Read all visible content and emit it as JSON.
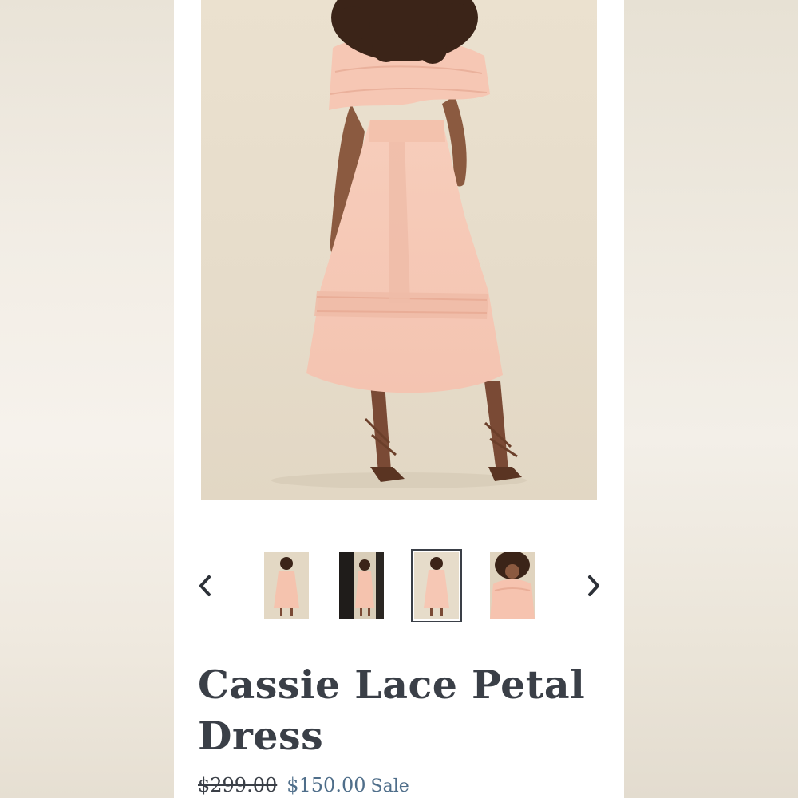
{
  "product": {
    "title": "Cassie Lace Petal Dress",
    "price_original": "$299.00",
    "price_sale": "$150.00",
    "sale_label": "Sale"
  },
  "gallery": {
    "main_image": "dress-back-view-photo",
    "thumbnails": [
      {
        "image": "full-front-view-photo",
        "selected": false
      },
      {
        "image": "doorway-view-photo",
        "selected": false
      },
      {
        "image": "back-view-photo",
        "selected": true
      },
      {
        "image": "closeup-front-view-photo",
        "selected": false
      }
    ],
    "prev_icon": "chevron-left-icon",
    "next_icon": "chevron-right-icon"
  },
  "colors": {
    "title": "#3a3f47",
    "sale_price": "#4f6e8a",
    "dress": "#f6c8b6",
    "backdrop": "#e6dcca"
  }
}
